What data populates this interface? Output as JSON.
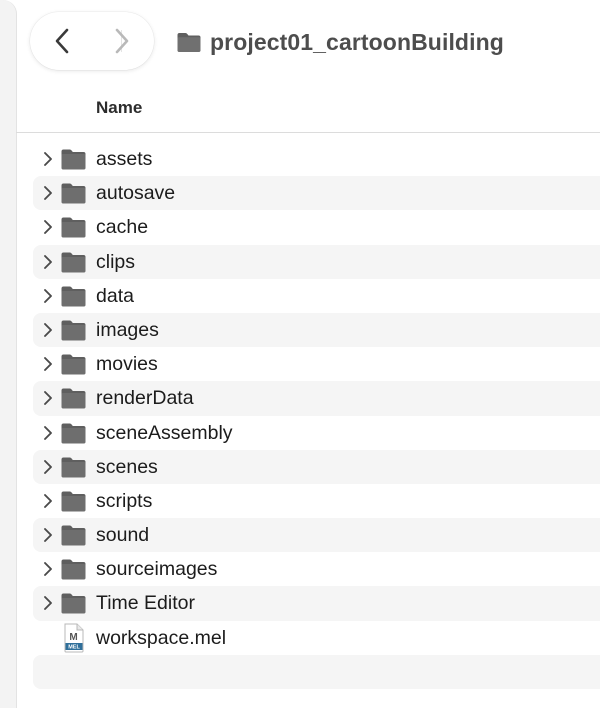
{
  "toolbar": {
    "title": "project01_cartoonBuilding"
  },
  "list_header": {
    "name_label": "Name"
  },
  "items": [
    {
      "name": "assets",
      "kind": "folder"
    },
    {
      "name": "autosave",
      "kind": "folder"
    },
    {
      "name": "cache",
      "kind": "folder"
    },
    {
      "name": "clips",
      "kind": "folder"
    },
    {
      "name": "data",
      "kind": "folder"
    },
    {
      "name": "images",
      "kind": "folder"
    },
    {
      "name": "movies",
      "kind": "folder"
    },
    {
      "name": "renderData",
      "kind": "folder"
    },
    {
      "name": "sceneAssembly",
      "kind": "folder"
    },
    {
      "name": "scenes",
      "kind": "folder"
    },
    {
      "name": "scripts",
      "kind": "folder"
    },
    {
      "name": "sound",
      "kind": "folder"
    },
    {
      "name": "sourceimages",
      "kind": "folder"
    },
    {
      "name": "Time Editor",
      "kind": "folder"
    },
    {
      "name": "workspace.mel",
      "kind": "mel-file",
      "icon_letter": "M",
      "icon_caption": "MEL"
    }
  ],
  "colors": {
    "folder": "#6e6e6e",
    "folder_tab": "#5f5f5f",
    "alt_row": "#f5f5f5",
    "mel_accent": "#2f6f9a"
  }
}
